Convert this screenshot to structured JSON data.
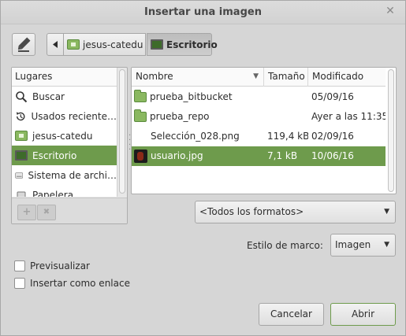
{
  "window": {
    "title": "Insertar una imagen",
    "close_icon": "close-icon"
  },
  "pathbar": {
    "crumbs": [
      {
        "label": "jesus-catedu",
        "icon": "home-folder-icon"
      },
      {
        "label": "Escritorio",
        "icon": "desktop-icon"
      }
    ]
  },
  "places": {
    "header": "Lugares",
    "items": [
      {
        "label": "Buscar",
        "icon": "search-icon"
      },
      {
        "label": "Usados reciente…",
        "icon": "recent-icon"
      },
      {
        "label": "jesus-catedu",
        "icon": "home-folder-icon"
      },
      {
        "label": "Escritorio",
        "icon": "desktop-icon"
      },
      {
        "label": "Sistema de archi…",
        "icon": "drive-icon"
      },
      {
        "label": "Papelera",
        "icon": "trash-icon"
      }
    ],
    "add_label": "+",
    "remove_label": "✖"
  },
  "files": {
    "columns": {
      "name": "Nombre",
      "size": "Tamaño",
      "modified": "Modificado"
    },
    "rows": [
      {
        "name": "prueba_bitbucket",
        "size": "",
        "modified": "05/09/16",
        "icon": "folder-icon"
      },
      {
        "name": "prueba_repo",
        "size": "",
        "modified": "Ayer a las 11:35",
        "icon": "folder-icon"
      },
      {
        "name": "Selección_028.png",
        "size": "119,4 kB",
        "modified": "02/09/16",
        "icon": "none"
      },
      {
        "name": "usuario.jpg",
        "size": "7,1 kB",
        "modified": "10/06/16",
        "icon": "image-thumbnail-icon"
      }
    ]
  },
  "filter": {
    "value": "<Todos los formatos>"
  },
  "frame": {
    "label": "Estilo de marco:",
    "value": "Imagen"
  },
  "options": {
    "preview": "Previsualizar",
    "insert_as_link": "Insertar como enlace"
  },
  "buttons": {
    "cancel": "Cancelar",
    "open": "Abrir"
  },
  "colors": {
    "selection": "#6e9b4c",
    "folder": "#8ab860"
  }
}
